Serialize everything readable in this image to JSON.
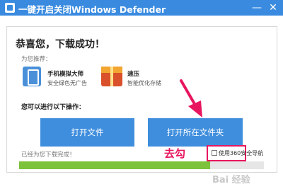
{
  "window": {
    "title": "一键开启关闭Windows Defender",
    "minimize_symbol": "—",
    "close_symbol": "✕"
  },
  "main": {
    "headline": "恭喜您，下载成功！",
    "recommend_label": "为您推荐：",
    "recommendations": [
      {
        "name": "手机模拟大师",
        "description": "安全绿色无广告",
        "icon": "phone-emulator-icon"
      },
      {
        "name": "速压",
        "description": "智能优化存储",
        "icon": "zip-compress-icon"
      }
    ],
    "operations_label": "您可以进行以下操作：",
    "buttons": {
      "open_file": "打开文件",
      "open_folder": "打开所在文件夹"
    },
    "status_text": "已经为您下载完成！",
    "progress_fraction": 0.78,
    "checkbox_label": "使用360安全导航",
    "checkbox_checked": false
  },
  "annotation": {
    "text": "去勾"
  },
  "colors": {
    "titlebar": "#3a8be0",
    "button": "#3f8edd",
    "progress": "#7cc23a",
    "annotation": "#e8165f"
  },
  "watermark": "Bai 经验"
}
